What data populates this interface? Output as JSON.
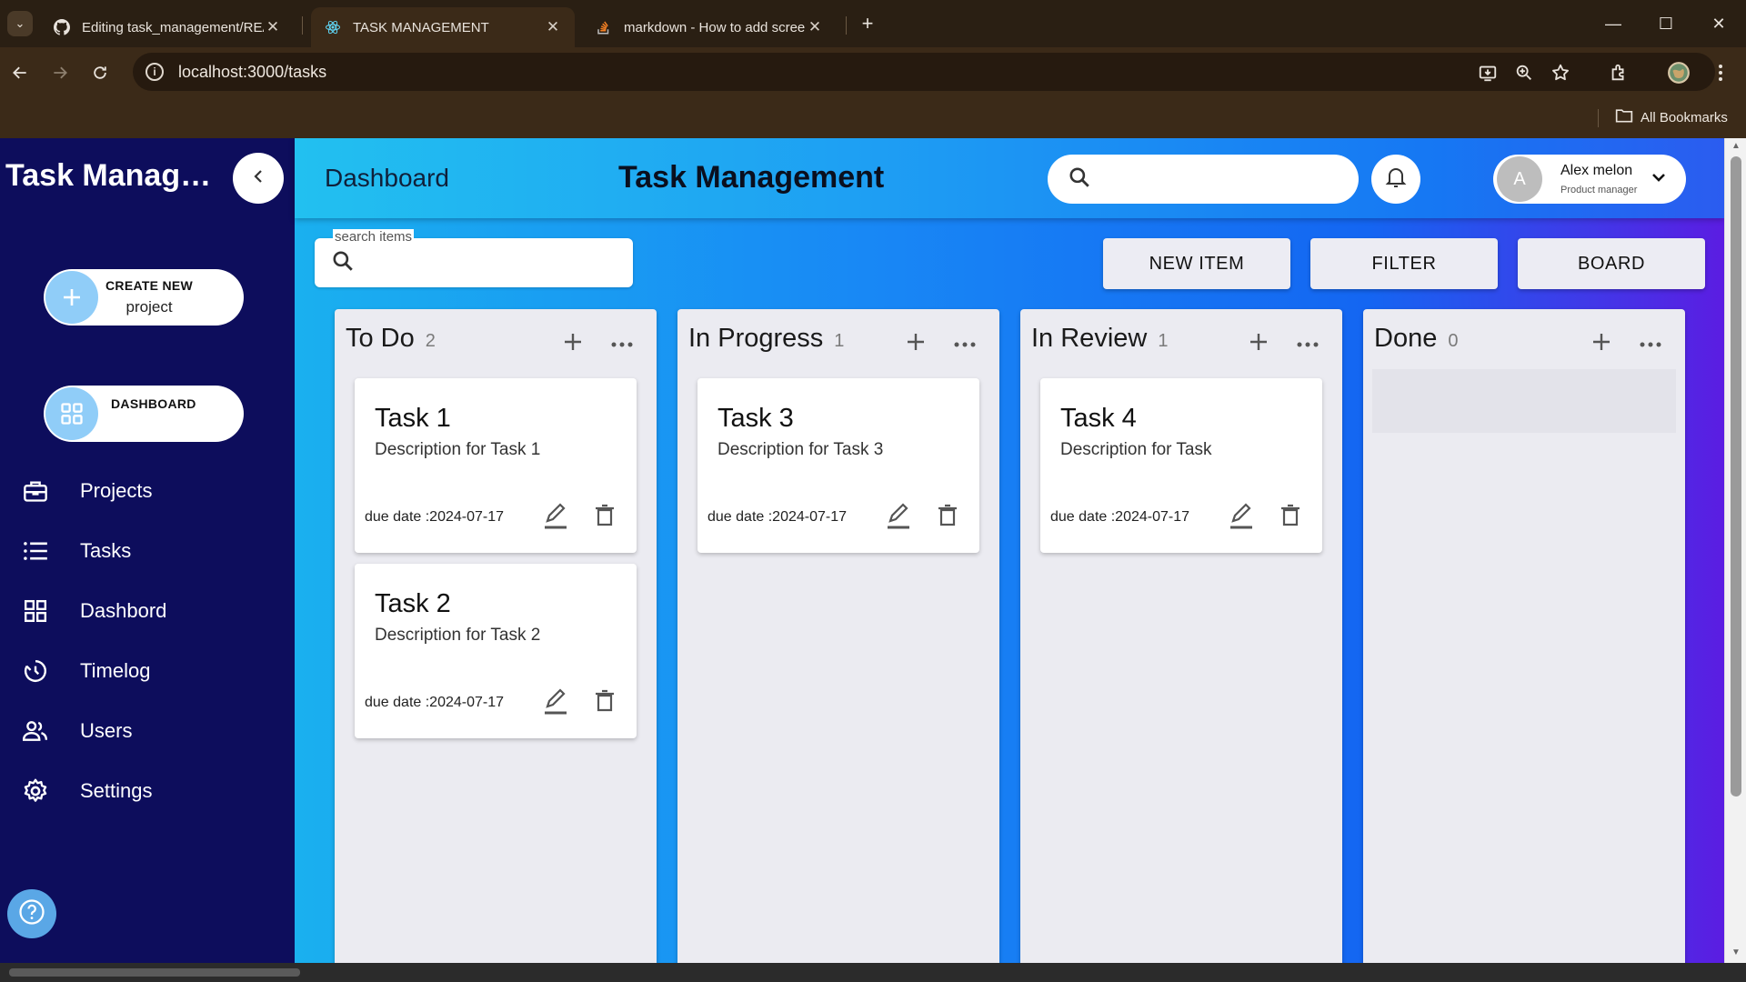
{
  "browser": {
    "tabs": [
      {
        "label": "Editing task_management/README.md",
        "icon": "github-icon"
      },
      {
        "label": "TASK MANAGEMENT",
        "icon": "react-icon"
      },
      {
        "label": "markdown - How to add screenshot",
        "icon": "stackoverflow-icon"
      }
    ],
    "url": "localhost:3000/tasks",
    "bookmarks_label": "All Bookmarks"
  },
  "sidebar": {
    "brand": "Task Management",
    "create_new": {
      "line1": "CREATE NEW",
      "line2": "project"
    },
    "dashboard_pill": "DASHBOARD",
    "items": [
      {
        "label": "Projects",
        "icon": "briefcase-icon"
      },
      {
        "label": "Tasks",
        "icon": "list-icon"
      },
      {
        "label": "Dashbord",
        "icon": "grid-icon"
      },
      {
        "label": "Timelog",
        "icon": "timer-icon"
      },
      {
        "label": "Users",
        "icon": "users-icon"
      },
      {
        "label": "Settings",
        "icon": "gear-icon"
      }
    ]
  },
  "header": {
    "breadcrumb": "Dashboard",
    "title": "Task Management",
    "search_placeholder": "",
    "user": {
      "initial": "A",
      "name": "Alex melon",
      "role": "Product manager"
    }
  },
  "toolbar": {
    "search_label": "search items",
    "new_item": "NEW ITEM",
    "filter": "FILTER",
    "board": "BOARD"
  },
  "columns": [
    {
      "title": "To Do",
      "count": "2",
      "cards": [
        {
          "title": "Task 1",
          "description": "Description for Task 1",
          "due": "due date :2024-07-17"
        },
        {
          "title": "Task 2",
          "description": "Description for Task 2",
          "due": "due date :2024-07-17"
        }
      ]
    },
    {
      "title": "In Progress",
      "count": "1",
      "cards": [
        {
          "title": "Task 3",
          "description": "Description for Task 3",
          "due": "due date :2024-07-17"
        }
      ]
    },
    {
      "title": "In Review",
      "count": "1",
      "cards": [
        {
          "title": "Task 4",
          "description": "Description for Task",
          "due": "due date :2024-07-17"
        }
      ]
    },
    {
      "title": "Done",
      "count": "0",
      "cards": []
    }
  ],
  "colors": {
    "sidebar_bg": "#0d0d5c",
    "accent_light_blue": "#90cdf8",
    "gradient_start": "#1ab0ef",
    "gradient_end": "#5b1de2"
  }
}
